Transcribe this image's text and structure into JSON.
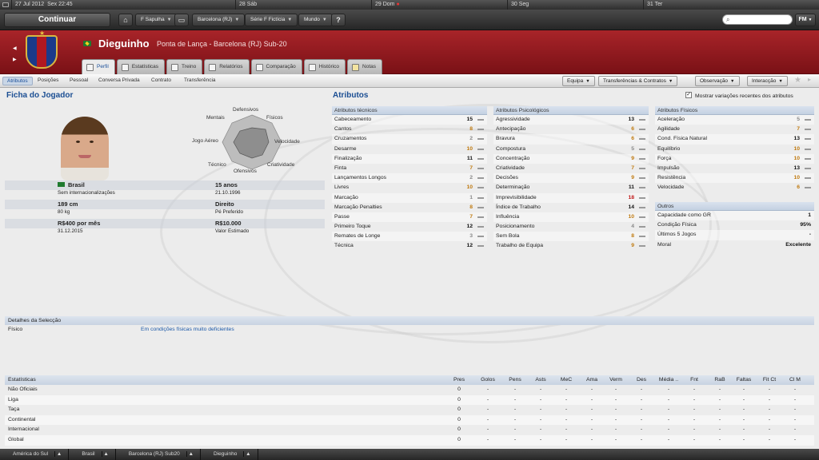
{
  "topbar": {
    "date": "27 Jul 2012",
    "time": "Sex 22:45",
    "d1": "28 Sáb",
    "d2": "29 Dom",
    "d3": "30 Seg",
    "d4": "31 Ter"
  },
  "toolbar": {
    "continue": "Continuar",
    "b1": "F Sapulha",
    "b2": "Barcelona (RJ)",
    "b3": "Série F Fictícia",
    "b4": "Mundo",
    "help": "?",
    "fm": "FM"
  },
  "player": {
    "name": "Dieguinho",
    "subtitle": "Ponta de Lança - Barcelona (RJ) Sub-20"
  },
  "tabs": [
    "Perfil",
    "Estatísticas",
    "Treino",
    "Relatórios",
    "Comparação",
    "Histórico",
    "Notas"
  ],
  "subnav": {
    "items": [
      "Atributos",
      "Posições",
      "Pessoal",
      "Conversa Privada",
      "Contrato",
      "Transferência"
    ],
    "menus": [
      "Equipa",
      "Transferências & Contratos",
      "Observação",
      "Interacção"
    ]
  },
  "card": {
    "title": "Ficha do Jogador",
    "nationality": "Brasil",
    "intl": "Sem internacionalizações",
    "age": "15 anos",
    "dob": "21.10.1996",
    "height": "189 cm",
    "weight": "80 kg",
    "foot": "Direito",
    "foot_label": "Pé Preferido",
    "wage": "R$400 por mês",
    "contract": "31.12.2015",
    "value": "R$10.000",
    "value_label": "Valor Estimado"
  },
  "radar": {
    "labels": [
      "Defensivos",
      "Físicos",
      "Velocidade",
      "Criatividade",
      "Ofensivos",
      "Técnico",
      "Jogo Aéreo",
      "Mentais"
    ]
  },
  "attributes": {
    "title": "Atributos",
    "show_changes": "Mostrar variações recentes dos atributos",
    "technical": {
      "title": "Atributos técnicos",
      "rows": [
        [
          "Cabeceamento",
          "15",
          "b"
        ],
        [
          "Cantos",
          "8",
          "o"
        ],
        [
          "Cruzamentos",
          "2",
          "g"
        ],
        [
          "Desarme",
          "10",
          "o"
        ],
        [
          "Finalização",
          "11",
          "b"
        ],
        [
          "Finta",
          "7",
          "o"
        ],
        [
          "Lançamentos Longos",
          "2",
          "g"
        ],
        [
          "Livres",
          "10",
          "o"
        ],
        [
          "Marcação",
          "1",
          "g"
        ],
        [
          "Marcação Penalties",
          "8",
          "o"
        ],
        [
          "Passe",
          "7",
          "o"
        ],
        [
          "Primeiro Toque",
          "12",
          "b"
        ],
        [
          "Remates de Longe",
          "3",
          "g"
        ],
        [
          "Técnica",
          "12",
          "b"
        ]
      ]
    },
    "mental": {
      "title": "Atributos Psicológicos",
      "rows": [
        [
          "Agressividade",
          "13",
          "b"
        ],
        [
          "Antecipação",
          "6",
          "o"
        ],
        [
          "Bravura",
          "6",
          "o"
        ],
        [
          "Compostura",
          "5",
          "g"
        ],
        [
          "Concentração",
          "9",
          "o"
        ],
        [
          "Criatividade",
          "7",
          "o"
        ],
        [
          "Decisões",
          "9",
          "o"
        ],
        [
          "Determinação",
          "11",
          "b"
        ],
        [
          "Imprevisibilidade",
          "18",
          "r"
        ],
        [
          "Índice de Trabalho",
          "14",
          "b"
        ],
        [
          "Influência",
          "10",
          "o"
        ],
        [
          "Posicionamento",
          "4",
          "g"
        ],
        [
          "Sem Bola",
          "8",
          "o"
        ],
        [
          "Trabalho de Equipa",
          "9",
          "o"
        ]
      ]
    },
    "physical": {
      "title": "Atributos Físicos",
      "rows": [
        [
          "Aceleração",
          "5",
          "g"
        ],
        [
          "Agilidade",
          "7",
          "o"
        ],
        [
          "Cond. Física Natural",
          "13",
          "b"
        ],
        [
          "Equilíbrio",
          "10",
          "o"
        ],
        [
          "Força",
          "10",
          "o"
        ],
        [
          "Impulsão",
          "13",
          "b"
        ],
        [
          "Resistência",
          "10",
          "o"
        ],
        [
          "Velocidade",
          "6",
          "o"
        ]
      ]
    },
    "other": {
      "title": "Outros",
      "rows": [
        [
          "Capacidade como GR",
          "1"
        ],
        [
          "Condição Física",
          "95%"
        ],
        [
          "Últimos 5 Jogos",
          "-"
        ],
        [
          "Moral",
          "Excelente"
        ]
      ]
    }
  },
  "selection": {
    "title": "Detalhes da Selecção",
    "label": "Físico",
    "value": "Em condições físicas muito deficientes"
  },
  "stats": {
    "headers": [
      "Estatísticas",
      "Pres",
      "Golos",
      "Pens",
      "Asts",
      "MeC",
      "Ama",
      "Verm",
      "Des",
      "Média ..",
      "Fnt",
      "RaB",
      "Faltas",
      "Fit Ct",
      "Cl M"
    ],
    "rows": [
      [
        "Não Oficiais",
        "0"
      ],
      [
        "Liga",
        "0"
      ],
      [
        "Taça",
        "0"
      ],
      [
        "Continental",
        "0"
      ],
      [
        "Internacional",
        "0"
      ],
      [
        "Global",
        "0"
      ]
    ],
    "dash": "-"
  },
  "statusbar": [
    "América do Sul",
    "Brasil",
    "Barcelona (RJ) Sub20",
    "Dieguinho"
  ]
}
